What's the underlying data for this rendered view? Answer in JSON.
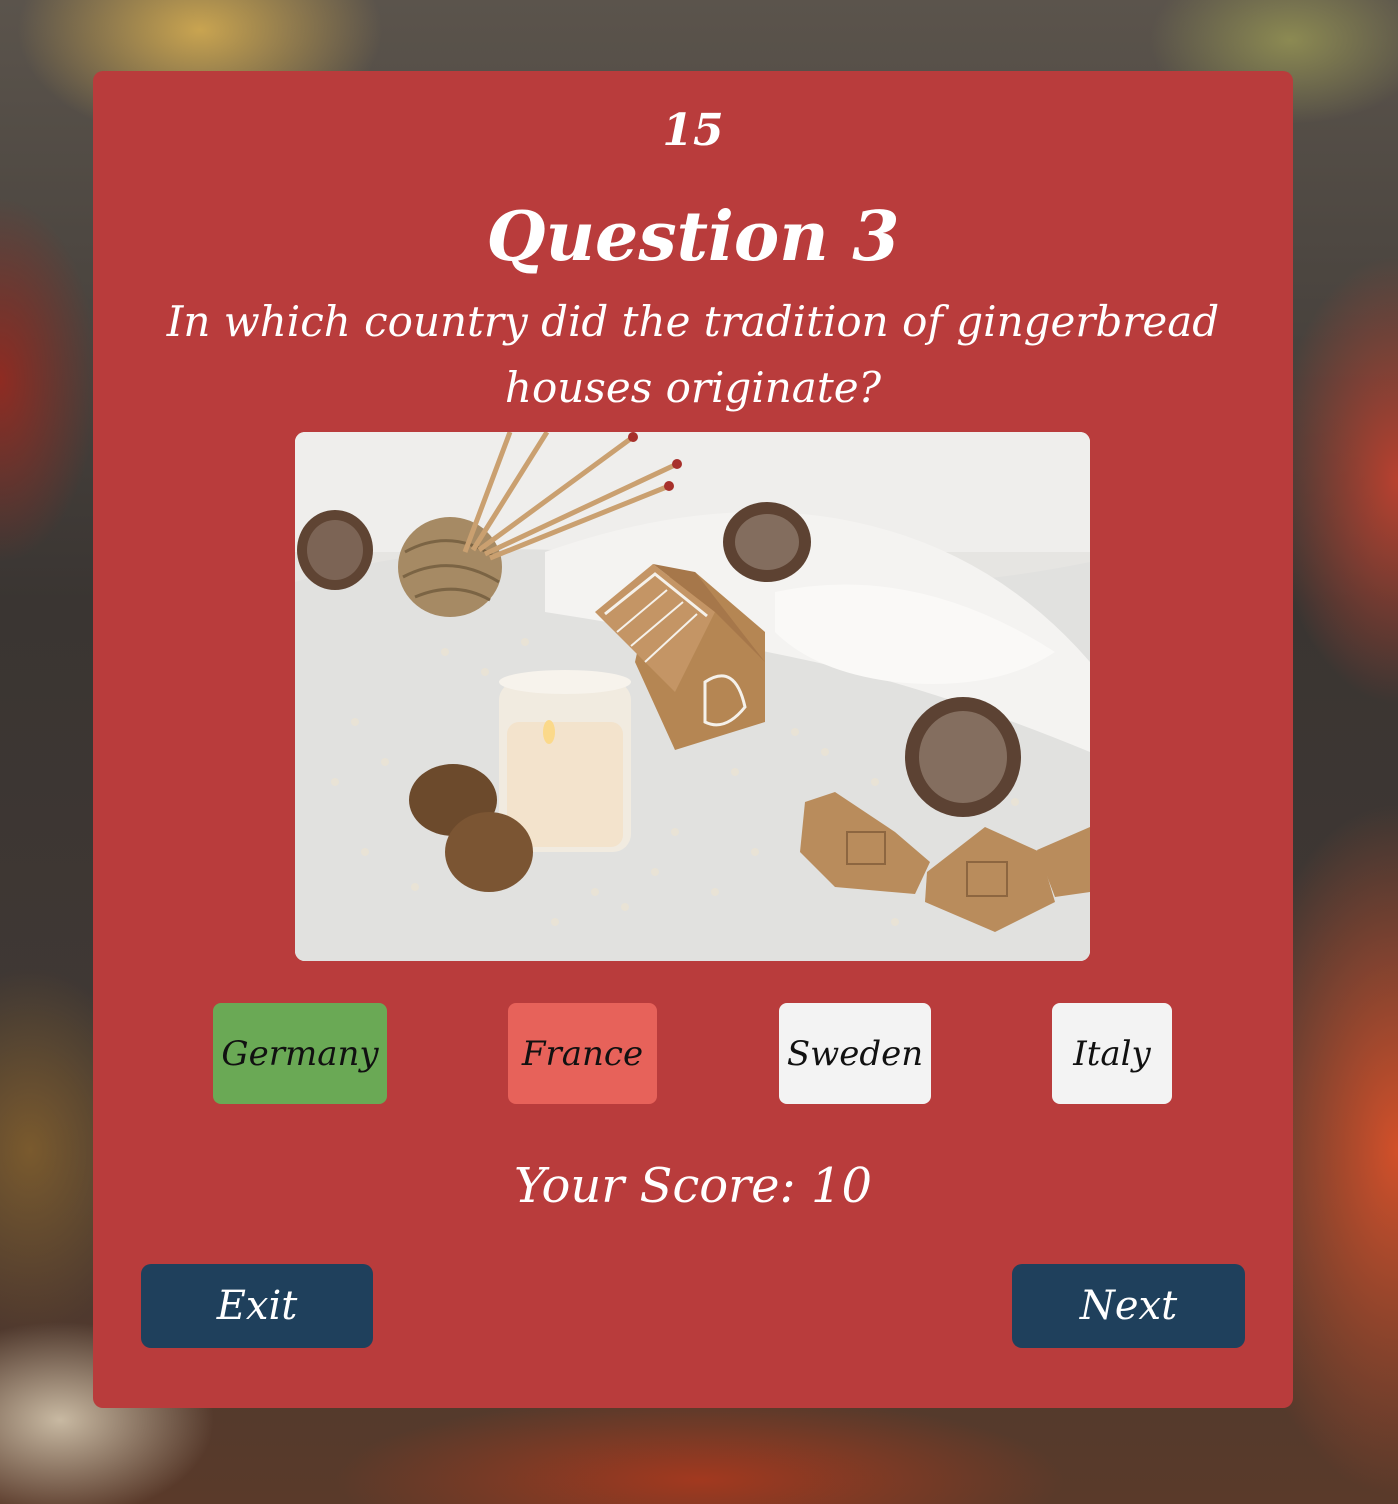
{
  "quiz": {
    "timer": "15",
    "question_number_label": "Question 3",
    "question_text": "In which country did the tradition of gingerbread houses originate?",
    "image_alt": "",
    "answers": [
      {
        "label": "Germany",
        "state": "correct",
        "color": "#6aa955"
      },
      {
        "label": "France",
        "state": "incorrect",
        "color": "#e7625a"
      },
      {
        "label": "Sweden",
        "state": "neutral",
        "color": "#f3f3f3"
      },
      {
        "label": "Italy",
        "state": "neutral",
        "color": "#f3f3f3"
      }
    ],
    "score_text": "Your Score: 10",
    "exit_label": "Exit",
    "next_label": "Next"
  },
  "colors": {
    "card": "#b93c3c",
    "nav_button": "#1f405c",
    "text": "#ffffff"
  }
}
